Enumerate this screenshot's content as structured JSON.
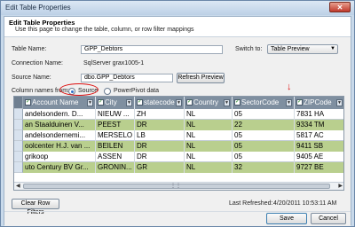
{
  "window": {
    "title": "Edit Table Properties",
    "close_label": "✕"
  },
  "header": {
    "title": "Edit Table Properties",
    "subtitle": "Use this page to change the table, column, or row filter mappings"
  },
  "form": {
    "table_name_label": "Table Name:",
    "table_name_value": "GPP_Debtors",
    "connection_name_label": "Connection Name:",
    "connection_name_value": "SqlServer grax1005-1",
    "source_name_label": "Source Name:",
    "source_name_value": "dbo.GPP_Debtors",
    "refresh_preview_label": "Refresh Preview",
    "switch_to_label": "Switch to:",
    "switch_to_value": "Table Preview",
    "column_names_from_label": "Column names from:",
    "radio_source_label": "Source",
    "radio_powerpivot_label": "PowerPivot data"
  },
  "grid": {
    "columns": [
      "Account Name",
      "City",
      "statecode",
      "Country",
      "SectorCode",
      "ZIPCode"
    ],
    "rows": [
      [
        "andelsondern. D...",
        "NIEUW ...",
        "ZH",
        "NL",
        "05",
        "7831 HA"
      ],
      [
        "an Staalduinen V...",
        "PEEST",
        "DR",
        "NL",
        "22",
        "9334 TM"
      ],
      [
        "andelsondernemi...",
        "MERSELO",
        "LB",
        "NL",
        "05",
        "5817 AC"
      ],
      [
        "oolcenter H.J. van ...",
        "BEILEN",
        "DR",
        "NL",
        "05",
        "9411 SB"
      ],
      [
        "grikoop",
        "ASSEN",
        "DR",
        "NL",
        "05",
        "9405 AE"
      ],
      [
        "uto Century BV Gr...",
        "GRONIN...",
        "GR",
        "NL",
        "32",
        "9727 BE"
      ]
    ]
  },
  "footer": {
    "clear_row_filters_label": "Clear Row Filters",
    "last_refreshed_label": "Last Refreshed:",
    "last_refreshed_value": "4/20/2011 10:53:11 AM",
    "save_label": "Save",
    "cancel_label": "Cancel"
  },
  "colors": {
    "header_bg": "#7f8fa0",
    "highlight_green": "#b9cf8e",
    "annotation_red": "#dd1111"
  }
}
